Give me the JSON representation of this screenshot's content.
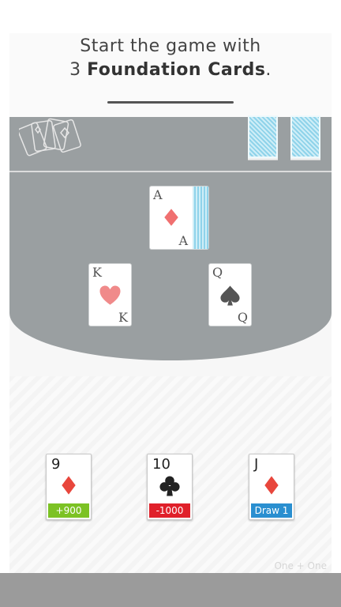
{
  "headline": {
    "line1": "Start the game with",
    "line2_prefix": "3 ",
    "line2_bold": "Foundation Cards",
    "line2_suffix": "."
  },
  "foundation": {
    "center": {
      "rank": "A",
      "suit": "diamond"
    },
    "left": {
      "rank": "K",
      "suit": "heart"
    },
    "right": {
      "rank": "Q",
      "suit": "spade"
    }
  },
  "hand": [
    {
      "rank": "9",
      "suit": "diamond",
      "badge": "+900",
      "badge_color": "#7cc224"
    },
    {
      "rank": "10",
      "suit": "club",
      "badge": "-1000",
      "badge_color": "#e0202a"
    },
    {
      "rank": "J",
      "suit": "diamond",
      "badge": "Draw 1",
      "badge_color": "#2a8fd0"
    }
  ],
  "colors": {
    "felt": "#9a9fa1",
    "red_suit": "#e8463c",
    "pink_suit": "#f07070",
    "black_suit": "#222222"
  },
  "brand": "One + One",
  "icons": [
    "card-fan-icon",
    "deck-icon",
    "diamond-icon",
    "heart-icon",
    "spade-icon",
    "club-icon"
  ]
}
